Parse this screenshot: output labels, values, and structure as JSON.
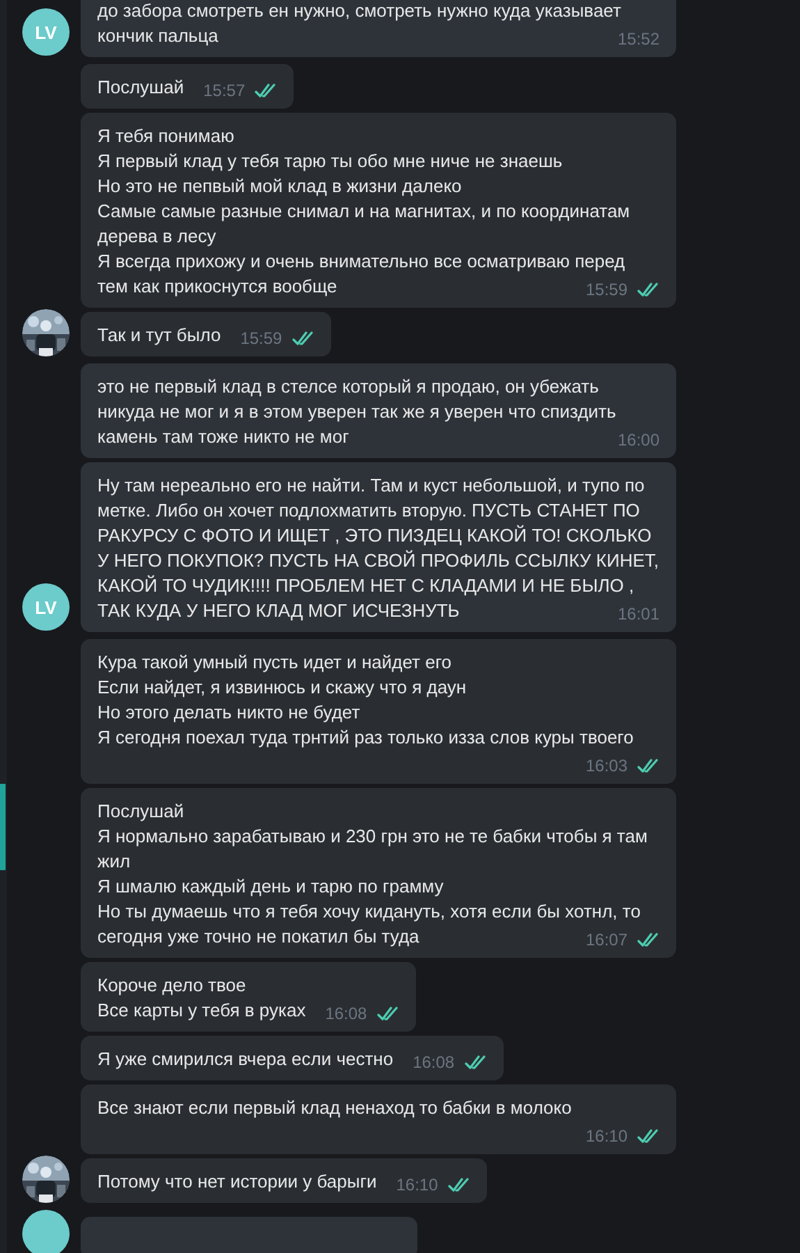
{
  "groups": [
    {
      "avatar": {
        "kind": "initials",
        "initials": "LV"
      },
      "messages": [
        {
          "text": "до забора смотреть ен нужно, смотреть нужно куда указывает кончик пальца",
          "time": "15:52",
          "read": false
        }
      ]
    },
    {
      "avatar": {
        "kind": "picture"
      },
      "messages": [
        {
          "text": "Послушай",
          "time": "15:57",
          "read": true
        },
        {
          "text": "Я тебя понимаю\nЯ первый клад у тебя тарю ты обо мне ниче не знаешь\nНо  это не пепвый мой клад в жизни далеко\nСамые самые разные снимал и на магнитах, и по координатам дерева в лесу\nЯ всегда прихожу и очень внимательно все осматриваю перед тем как прикоснутся вообще",
          "time": "15:59",
          "read": true
        },
        {
          "text": "Так и тут было",
          "time": "15:59",
          "read": true
        }
      ]
    },
    {
      "avatar": {
        "kind": "initials",
        "initials": "LV"
      },
      "messages": [
        {
          "text": "это не первый клад в стелсе который я продаю, он убежать никуда не мог и я в этом уверен так же я уверен что спиздить камень там тоже никто не мог",
          "time": "16:00",
          "read": false
        },
        {
          "text": "Ну там нереально его не найти. Там и куст небольшой, и тупо по метке. Либо он хочет подлохматить вторую. ПУСТЬ СТАНЕТ ПО РАКУРСУ С ФОТО И ИЩЕТ , ЭТО ПИЗДЕЦ КАКОЙ ТО! СКОЛЬКО У НЕГО ПОКУПОК? ПУСТЬ НА СВОЙ ПРОФИЛЬ ССЫЛКУ КИНЕТ, КАКОЙ ТО ЧУДИК!!!! ПРОБЛЕМ НЕТ С КЛАДАМИ И НЕ БЫЛО , ТАК КУДА У НЕГО КЛАД МОГ ИСЧЕЗНУТЬ",
          "time": "16:01",
          "read": false
        }
      ]
    },
    {
      "avatar": {
        "kind": "picture"
      },
      "messages": [
        {
          "text": "Кура такой умный пусть идет и найдет его\nЕсли найдет, я извинюсь и скажу что я даун\nНо этого делать никто не будет\nЯ сегодня поехал туда трнтий раз только изза слов куры твоего",
          "time": "16:03",
          "read": true
        },
        {
          "text": "Послушай\nЯ нормально зарабатываю и 230 грн это не те бабки чтобы я там жил\nЯ шмалю каждый день и тарю по грамму\nНо ты думаешь что я тебя хочу кидануть, хотя если бы хотнл, то сегодня уже точно не покатил бы туда",
          "time": "16:07",
          "read": true
        },
        {
          "text": "Короче дело твое\nВсе карты у тебя в руках",
          "time": "16:08",
          "read": true
        },
        {
          "text": "Я уже смирился вчера если честно",
          "time": "16:08",
          "read": true
        },
        {
          "text": "Все знают если первый клад ненаход то бабки в молоко",
          "time": "16:10",
          "read": true
        },
        {
          "text": "Потому что нет истории у барыги",
          "time": "16:10",
          "read": true
        }
      ]
    }
  ]
}
